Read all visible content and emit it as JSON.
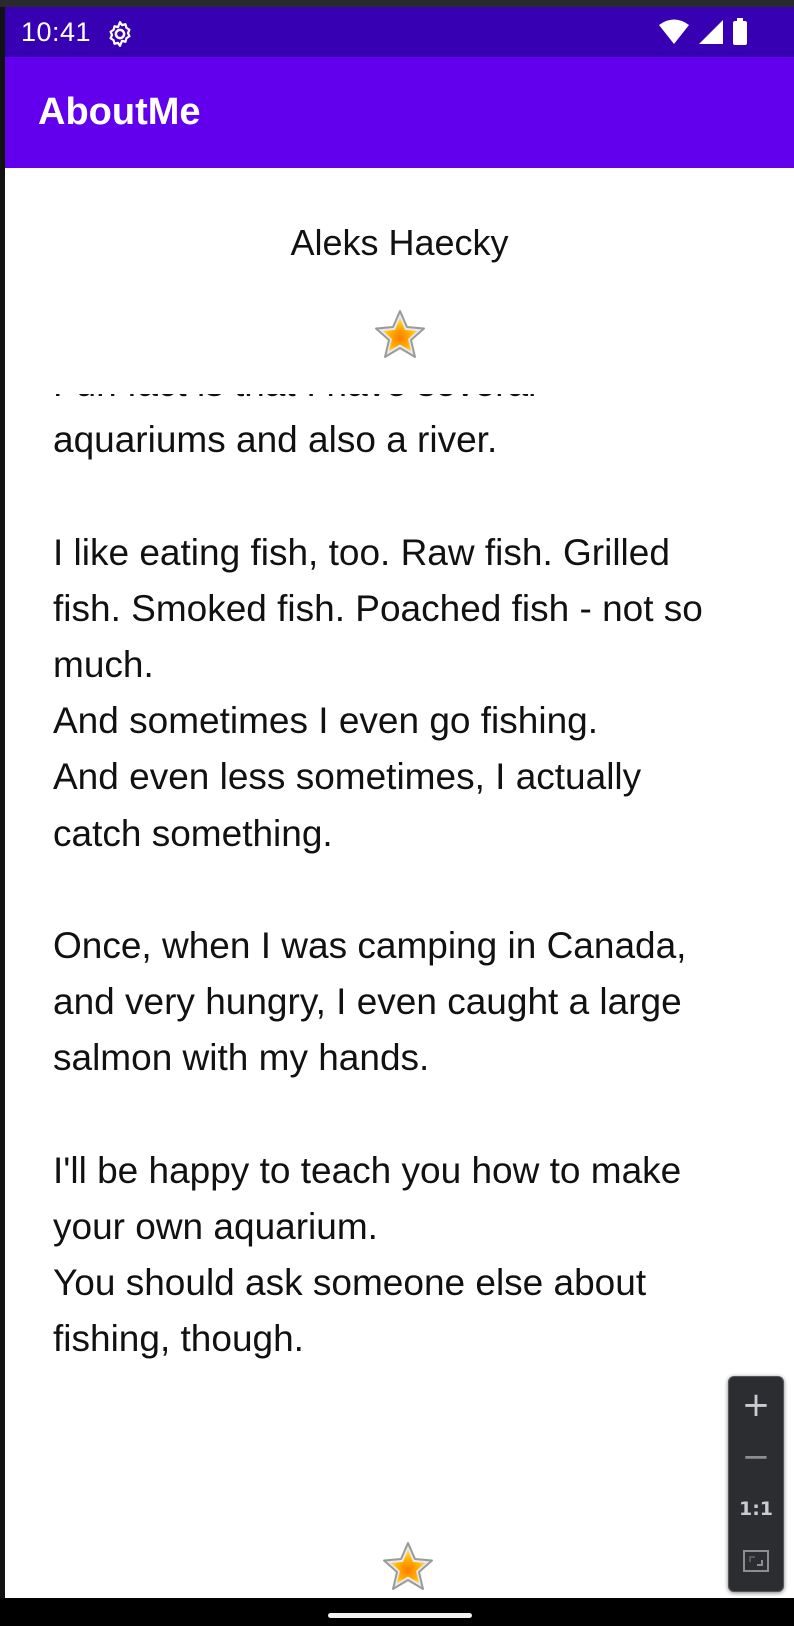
{
  "status_bar": {
    "time": "10:41",
    "icons": [
      "settings-icon",
      "wifi-icon",
      "cell-signal-icon",
      "battery-icon"
    ]
  },
  "app_bar": {
    "title": "AboutMe"
  },
  "profile": {
    "name": "Aleks Haecky",
    "bio": "Fun fact is that I have several\naquariums and also a river.\n\nI like eating fish, too. Raw fish. Grilled\nfish. Smoked fish. Poached fish - not so\nmuch.\nAnd sometimes I even go fishing.\nAnd even less sometimes, I actually\ncatch something.\n\nOnce, when I was camping in Canada,\nand very hungry, I even caught a large\nsalmon with my hands.\n\nI'll be happy to teach you how to make\nyour own aquarium.\nYou should ask someone else about\nfishing, though."
  },
  "zoom_controls": {
    "zoom_in": "+",
    "zoom_out": "−",
    "actual_size": "1:1"
  },
  "colors": {
    "status_bar": "#3700b3",
    "app_bar": "#6200ee",
    "background": "#ffffff",
    "text": "#111111"
  }
}
